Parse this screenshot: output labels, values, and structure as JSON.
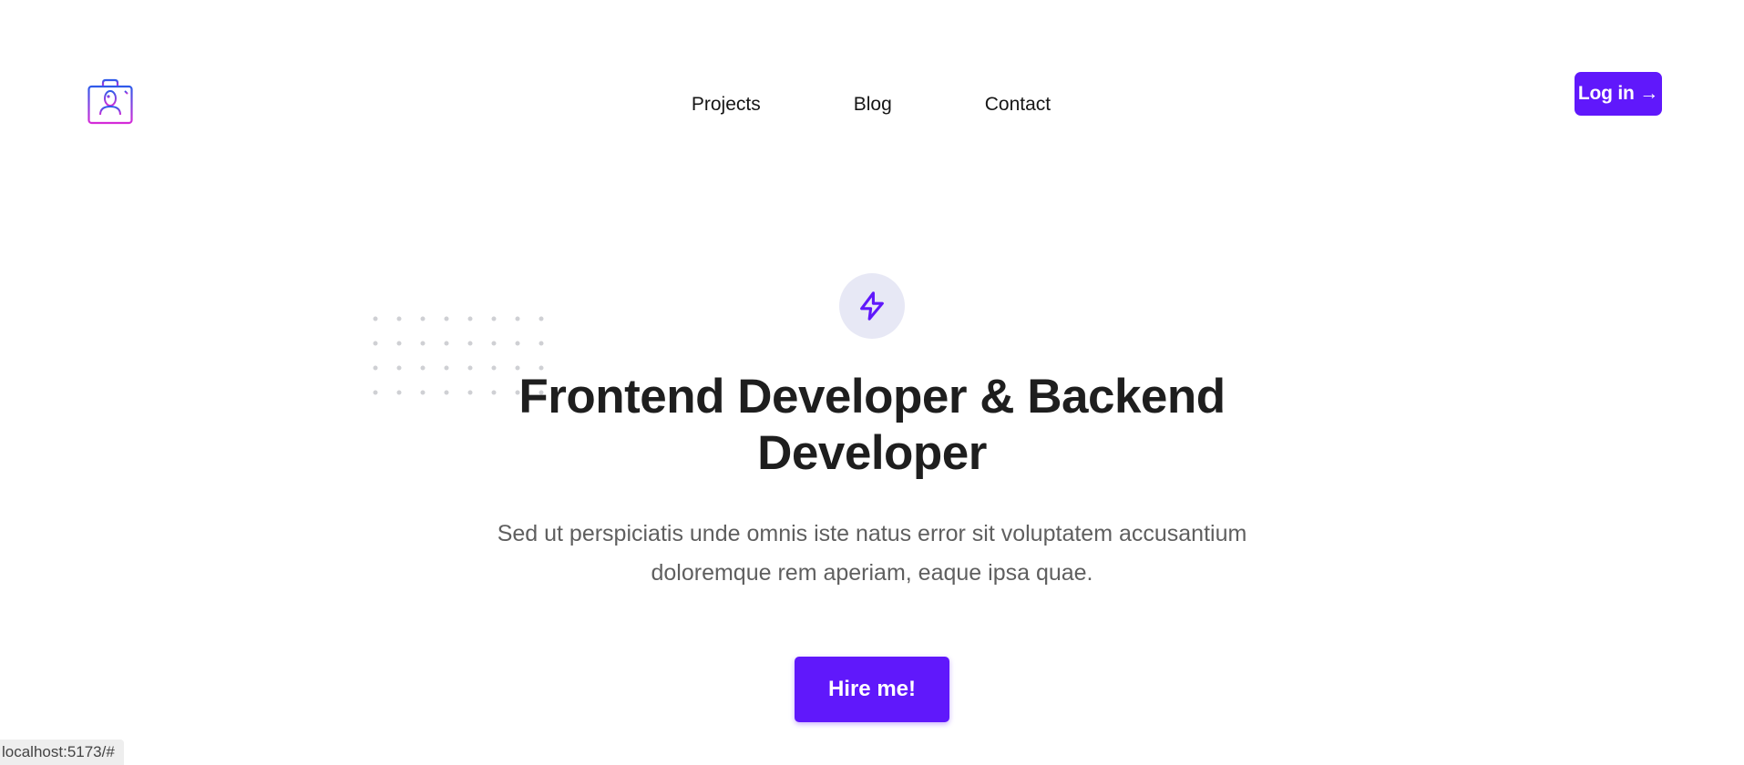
{
  "header": {
    "logo_icon": "portfolio-briefcase-user-icon",
    "nav": [
      {
        "label": "Projects"
      },
      {
        "label": "Blog"
      },
      {
        "label": "Contact"
      }
    ],
    "login_label": "Log in →"
  },
  "hero": {
    "badge_icon": "lightning-bolt-icon",
    "title_line1": "Frontend Developer & Backend",
    "title_line2": "Developer",
    "subtitle_line1": "Sed ut perspiciatis unde omnis iste natus error sit voluptatem accusantium",
    "subtitle_line2": "doloremque rem aperiam, eaque ipsa quae.",
    "cta_label": "Hire me!"
  },
  "status_bar": {
    "url": "localhost:5173/#"
  },
  "colors": {
    "accent": "#6018fb",
    "badge_bg": "#e7e8f5",
    "heading": "#1e1e1e",
    "body_text": "#5f5f5f"
  }
}
